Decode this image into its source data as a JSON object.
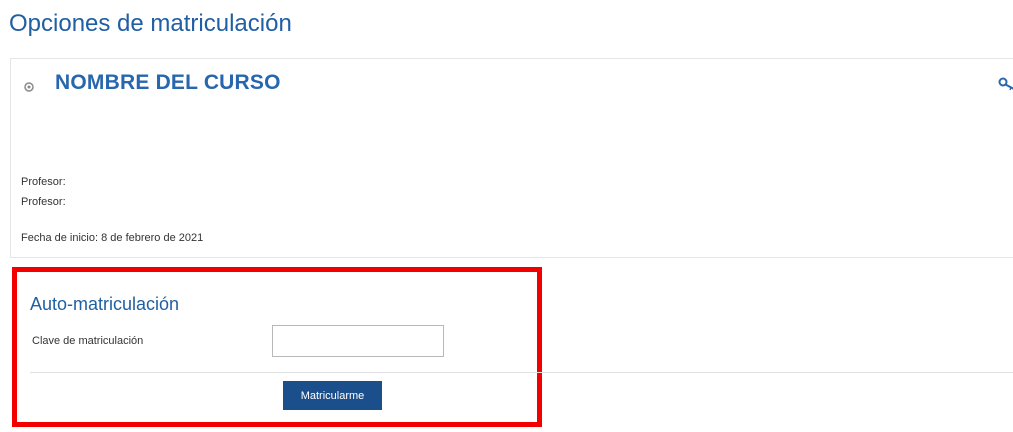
{
  "page": {
    "title": "Opciones de matriculación"
  },
  "course": {
    "name": "NOMBRE DEL CURSO",
    "icon": "course-puzzle-icon",
    "key_icon": "key-icon",
    "teachers": [
      "Profesor:",
      "Profesor:"
    ],
    "start_date": "Fecha de inicio: 8 de febrero de 2021"
  },
  "self_enrolment": {
    "title": "Auto-matriculación",
    "key_label": "Clave de matriculación",
    "key_value": "",
    "submit_label": "Matricularme"
  },
  "colors": {
    "title": "#1f5fa3",
    "button": "#1b4f8c",
    "highlight": "#f20000"
  }
}
